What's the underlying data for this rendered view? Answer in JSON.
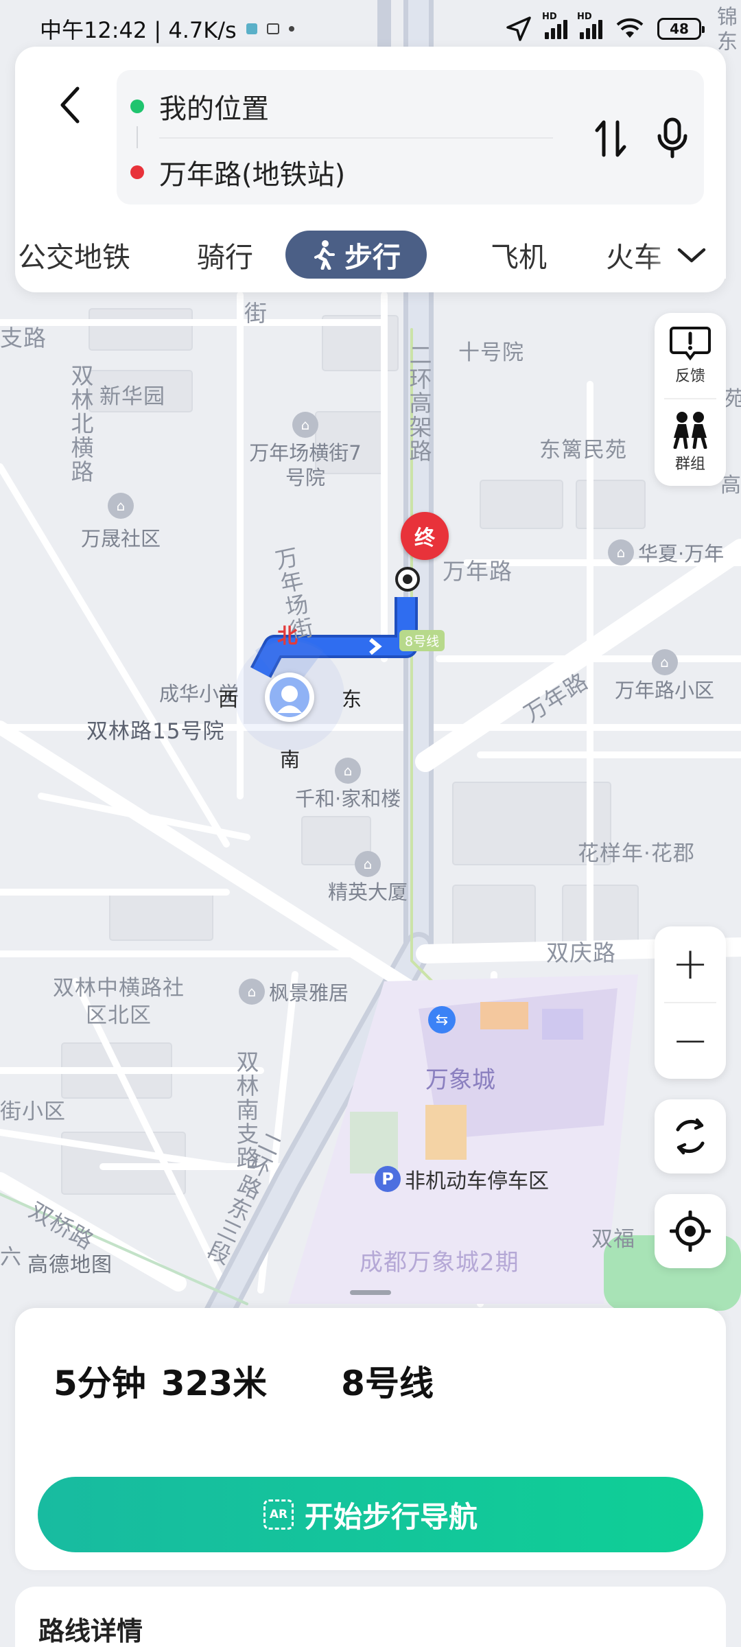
{
  "status_bar": {
    "time": "中午12:42 | 4.7K/s",
    "battery": "48",
    "hd1": "HD",
    "hd2": "HD"
  },
  "route": {
    "origin": "我的位置",
    "destination": "万年路(地铁站)",
    "origin_color": "#1fc46e",
    "destination_color": "#e8323a"
  },
  "modes": {
    "tabs": [
      "公交地铁",
      "骑行",
      "步行",
      "飞机",
      "火车"
    ],
    "active": "步行"
  },
  "map": {
    "road_labels": [
      "二环高架路",
      "万年路",
      "双庆路",
      "双桥路",
      "二环路东三段",
      "双林北横路",
      "万年场街",
      "双林南支路",
      "支路",
      "街"
    ],
    "area_labels": [
      "新华园",
      "十号院",
      "东篱民苑",
      "万晟社区",
      "双林路15号院",
      "双林中横路社区北区",
      "街小区",
      "花样年·花郡",
      "万年路小区",
      "成都万象城2期",
      "六",
      "双福"
    ],
    "pois": [
      "万年场横街7号院",
      "华夏·万年",
      "成华小学",
      "千和·家和楼",
      "精英大厦",
      "枫景雅居",
      "万象城",
      "非机动车停车区"
    ],
    "compass": {
      "north": "北",
      "south": "南",
      "east": "东",
      "west": "西"
    },
    "end_marker": "终",
    "station_label": "万年路",
    "line_badge": "8号线",
    "watermark": "高德地图",
    "route_color": "#2f6df0",
    "edge_labels": [
      "锦",
      "东",
      "苑",
      "高"
    ]
  },
  "tools": {
    "feedback": "反馈",
    "group": "群组",
    "zoom_in": "+",
    "zoom_out": "−"
  },
  "summary": {
    "duration": "5分钟",
    "distance": "323米",
    "line": "8号线",
    "nav_button": "开始步行导航",
    "ar_badge": "AR",
    "details_title": "路线详情"
  }
}
